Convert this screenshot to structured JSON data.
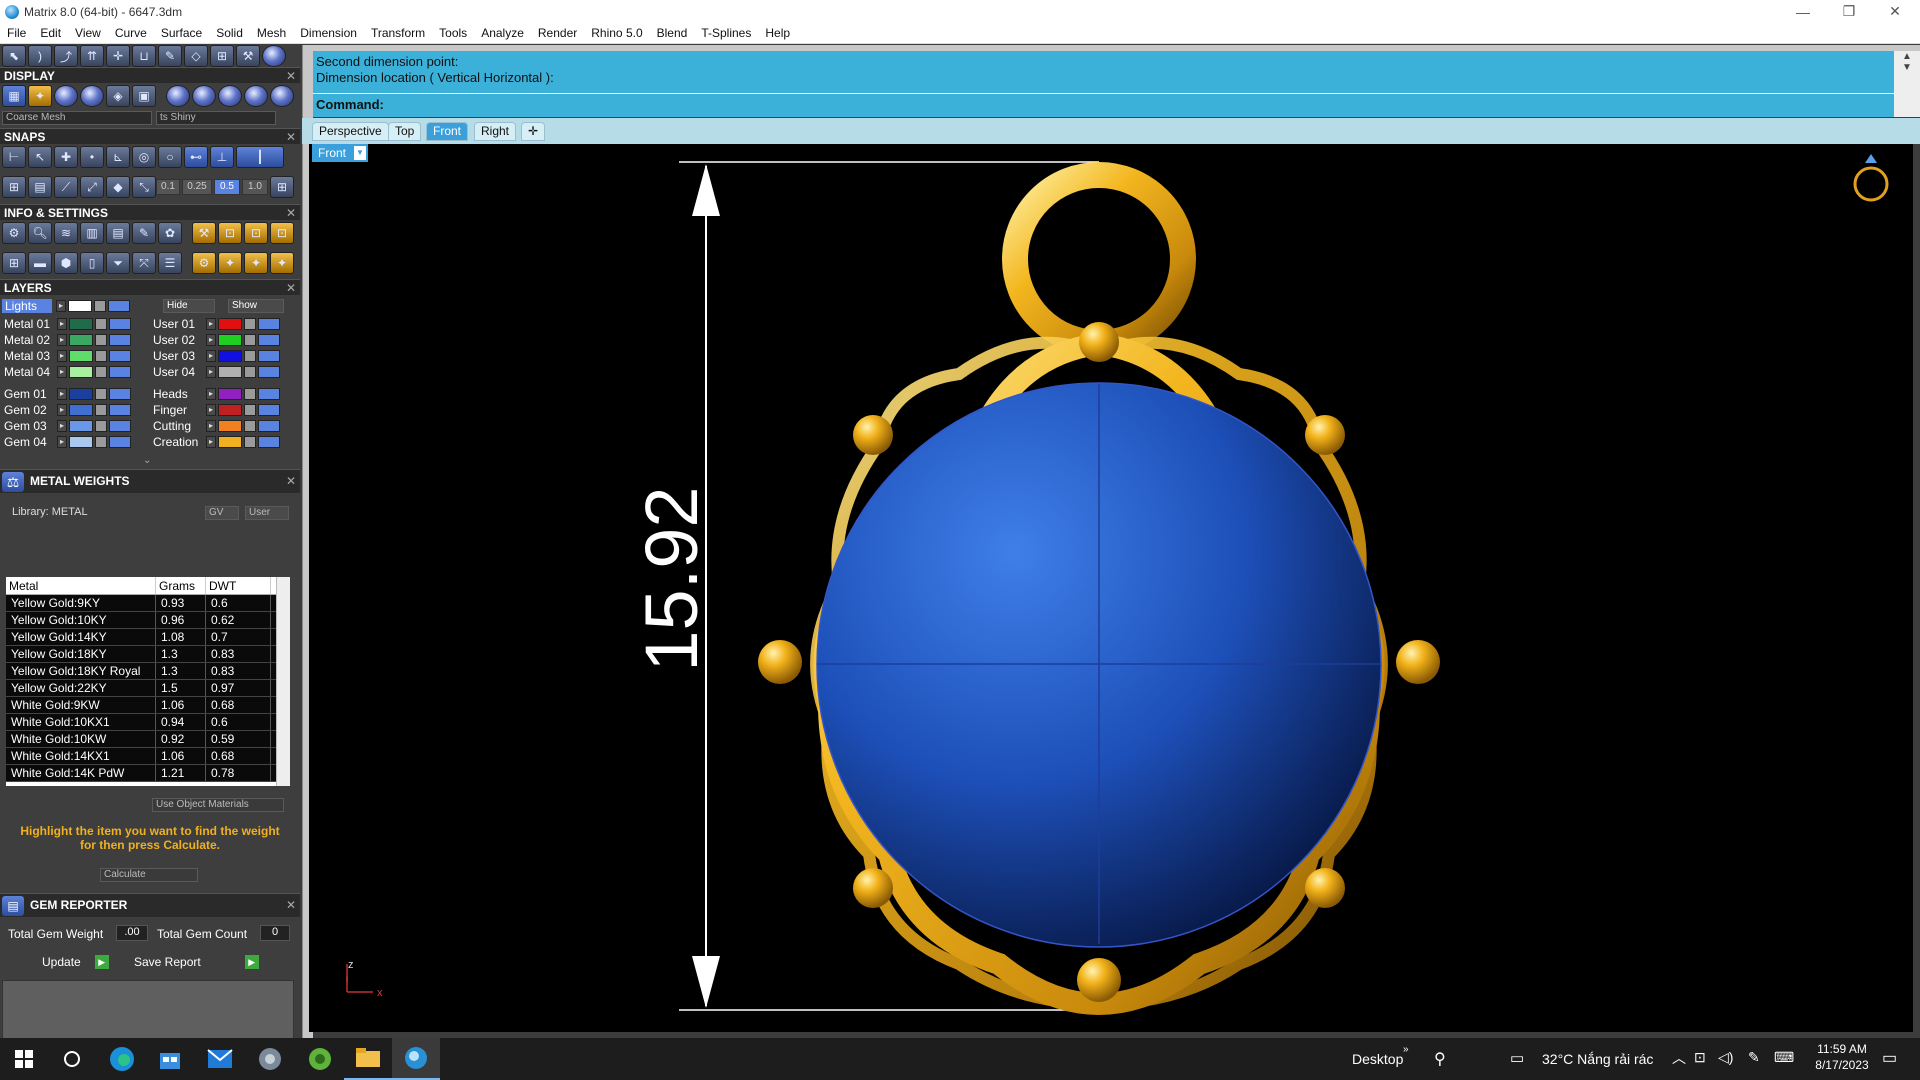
{
  "window": {
    "title": "Matrix 8.0 (64-bit) - 6647.3dm",
    "min_label": "—",
    "max_label": "❐",
    "close_label": "✕"
  },
  "menu": [
    "File",
    "Edit",
    "View",
    "Curve",
    "Surface",
    "Solid",
    "Mesh",
    "Dimension",
    "Transform",
    "Tools",
    "Analyze",
    "Render",
    "Rhino 5.0",
    "Blend",
    "T-Splines",
    "Help"
  ],
  "panels": {
    "display": {
      "title": "DISPLAY",
      "mesh_select": "Coarse Mesh",
      "material_select": "ts Shiny"
    },
    "snaps": {
      "title": "SNAPS",
      "values": [
        "0.1",
        "0.25",
        "0.5",
        "1.0"
      ]
    },
    "info_settings": {
      "title": "INFO & SETTINGS"
    },
    "layers": {
      "title": "LAYERS",
      "lights_label": "Lights",
      "hide_label": "Hide",
      "show_label": "Show",
      "left": [
        {
          "name": "Metal 01",
          "color": "#1f6b4a"
        },
        {
          "name": "Metal 02",
          "color": "#3aa860"
        },
        {
          "name": "Metal 03",
          "color": "#5fdc6a"
        },
        {
          "name": "Metal 04",
          "color": "#a8f0a0"
        },
        {
          "name": "Gem 01",
          "color": "#1b3f9e"
        },
        {
          "name": "Gem 02",
          "color": "#3f6fd0"
        },
        {
          "name": "Gem 03",
          "color": "#6a98e8"
        },
        {
          "name": "Gem 04",
          "color": "#a8c8f0"
        }
      ],
      "right": [
        {
          "name": "User 01",
          "color": "#e01010"
        },
        {
          "name": "User 02",
          "color": "#20d020"
        },
        {
          "name": "User 03",
          "color": "#1010e0"
        },
        {
          "name": "User 04",
          "color": "#b0b0b0"
        },
        {
          "name": "Heads",
          "color": "#9020c0"
        },
        {
          "name": "Finger",
          "color": "#c02020"
        },
        {
          "name": "Cutting",
          "color": "#f08020"
        },
        {
          "name": "Creation",
          "color": "#f0b020"
        }
      ]
    },
    "metal_weights": {
      "title": "METAL WEIGHTS",
      "library_label": "Library: METAL",
      "gv_label": "GV",
      "user_label": "User",
      "columns": [
        "Metal",
        "Grams",
        "DWT"
      ],
      "rows": [
        [
          "Yellow Gold:9KY",
          "0.93",
          "0.6"
        ],
        [
          "Yellow Gold:10KY",
          "0.96",
          "0.62"
        ],
        [
          "Yellow Gold:14KY",
          "1.08",
          "0.7"
        ],
        [
          "Yellow Gold:18KY",
          "1.3",
          "0.83"
        ],
        [
          "Yellow Gold:18KY Royal",
          "1.3",
          "0.83"
        ],
        [
          "Yellow Gold:22KY",
          "1.5",
          "0.97"
        ],
        [
          "White Gold:9KW",
          "1.06",
          "0.68"
        ],
        [
          "White Gold:10KX1",
          "0.94",
          "0.6"
        ],
        [
          "White Gold:10KW",
          "0.92",
          "0.59"
        ],
        [
          "White Gold:14KX1",
          "1.06",
          "0.68"
        ],
        [
          "White Gold:14K PdW",
          "1.21",
          "0.78"
        ]
      ],
      "use_object_materials": "Use Object Materials",
      "hint": "Highlight the item you want to find the weight for then press Calculate.",
      "calculate_label": "Calculate"
    },
    "gem_reporter": {
      "title": "GEM REPORTER",
      "total_weight_label": "Total Gem Weight",
      "total_weight_value": ".00",
      "total_count_label": "Total Gem Count",
      "total_count_value": "0",
      "update_label": "Update",
      "save_report_label": "Save Report"
    }
  },
  "command": {
    "history": [
      "Second dimension point:",
      "Dimension location ( Vertical  Horizontal ):"
    ],
    "prompt": "Command:"
  },
  "viewport": {
    "tabs": [
      "Perspective",
      "Top",
      "Front",
      "Right"
    ],
    "active_tab": "Front",
    "label": "Front",
    "dimension_text": "15.92",
    "axis_z": "z",
    "axis_x": "x",
    "gold": "#e8a516",
    "gem": "#1d4fb8"
  },
  "taskbar": {
    "desktop_label": "Desktop",
    "weather": "32°C  Nắng rải rác",
    "time": "11:59 AM",
    "date": "8/17/2023"
  }
}
